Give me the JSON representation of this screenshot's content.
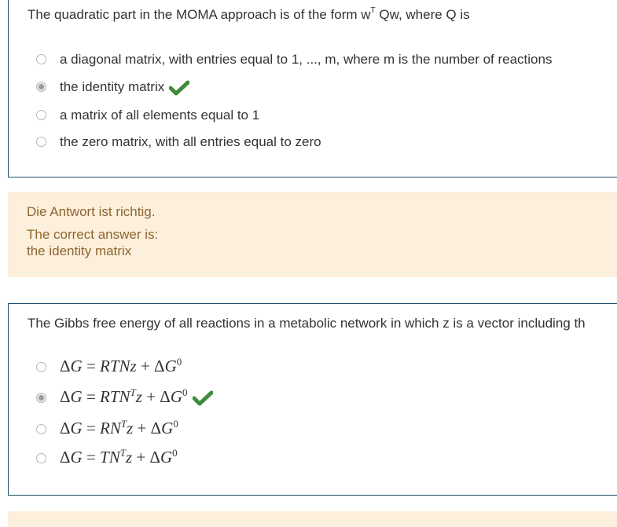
{
  "question1": {
    "text_before": "The quadratic part in the MOMA approach is of the form w",
    "text_sup": "T",
    "text_after": " Qw, where Q is",
    "options": [
      {
        "label": "a diagonal matrix, with entries equal to 1, ..., m, where m is the number of reactions",
        "selected": false,
        "correct": false
      },
      {
        "label": "the identity matrix",
        "selected": true,
        "correct": true
      },
      {
        "label": "a matrix of all elements equal to 1",
        "selected": false,
        "correct": false
      },
      {
        "label": "the zero matrix, with all entries equal to zero",
        "selected": false,
        "correct": false
      }
    ]
  },
  "feedback1": {
    "status": "Die Antwort ist richtig.",
    "correct_label": "The correct answer is:",
    "correct_value": "the identity matrix"
  },
  "question2": {
    "text": "The Gibbs free energy of all reactions in a metabolic network in which z is a vector including th",
    "options": [
      {
        "label": "ΔG = RTNz + ΔG⁰",
        "selected": false,
        "correct": false
      },
      {
        "label": "ΔG = RTNᵀz + ΔG⁰",
        "selected": true,
        "correct": true
      },
      {
        "label": "ΔG = RNᵀz + ΔG⁰",
        "selected": false,
        "correct": false
      },
      {
        "label": "ΔG = TNᵀz + ΔG⁰",
        "selected": false,
        "correct": false
      }
    ]
  },
  "colors": {
    "question_border": "#1c4e6b",
    "feedback_bg": "#fcefdc",
    "feedback_text": "#8e662e",
    "check": "#3f8b3a"
  },
  "icons": {
    "correct": "check-icon"
  }
}
